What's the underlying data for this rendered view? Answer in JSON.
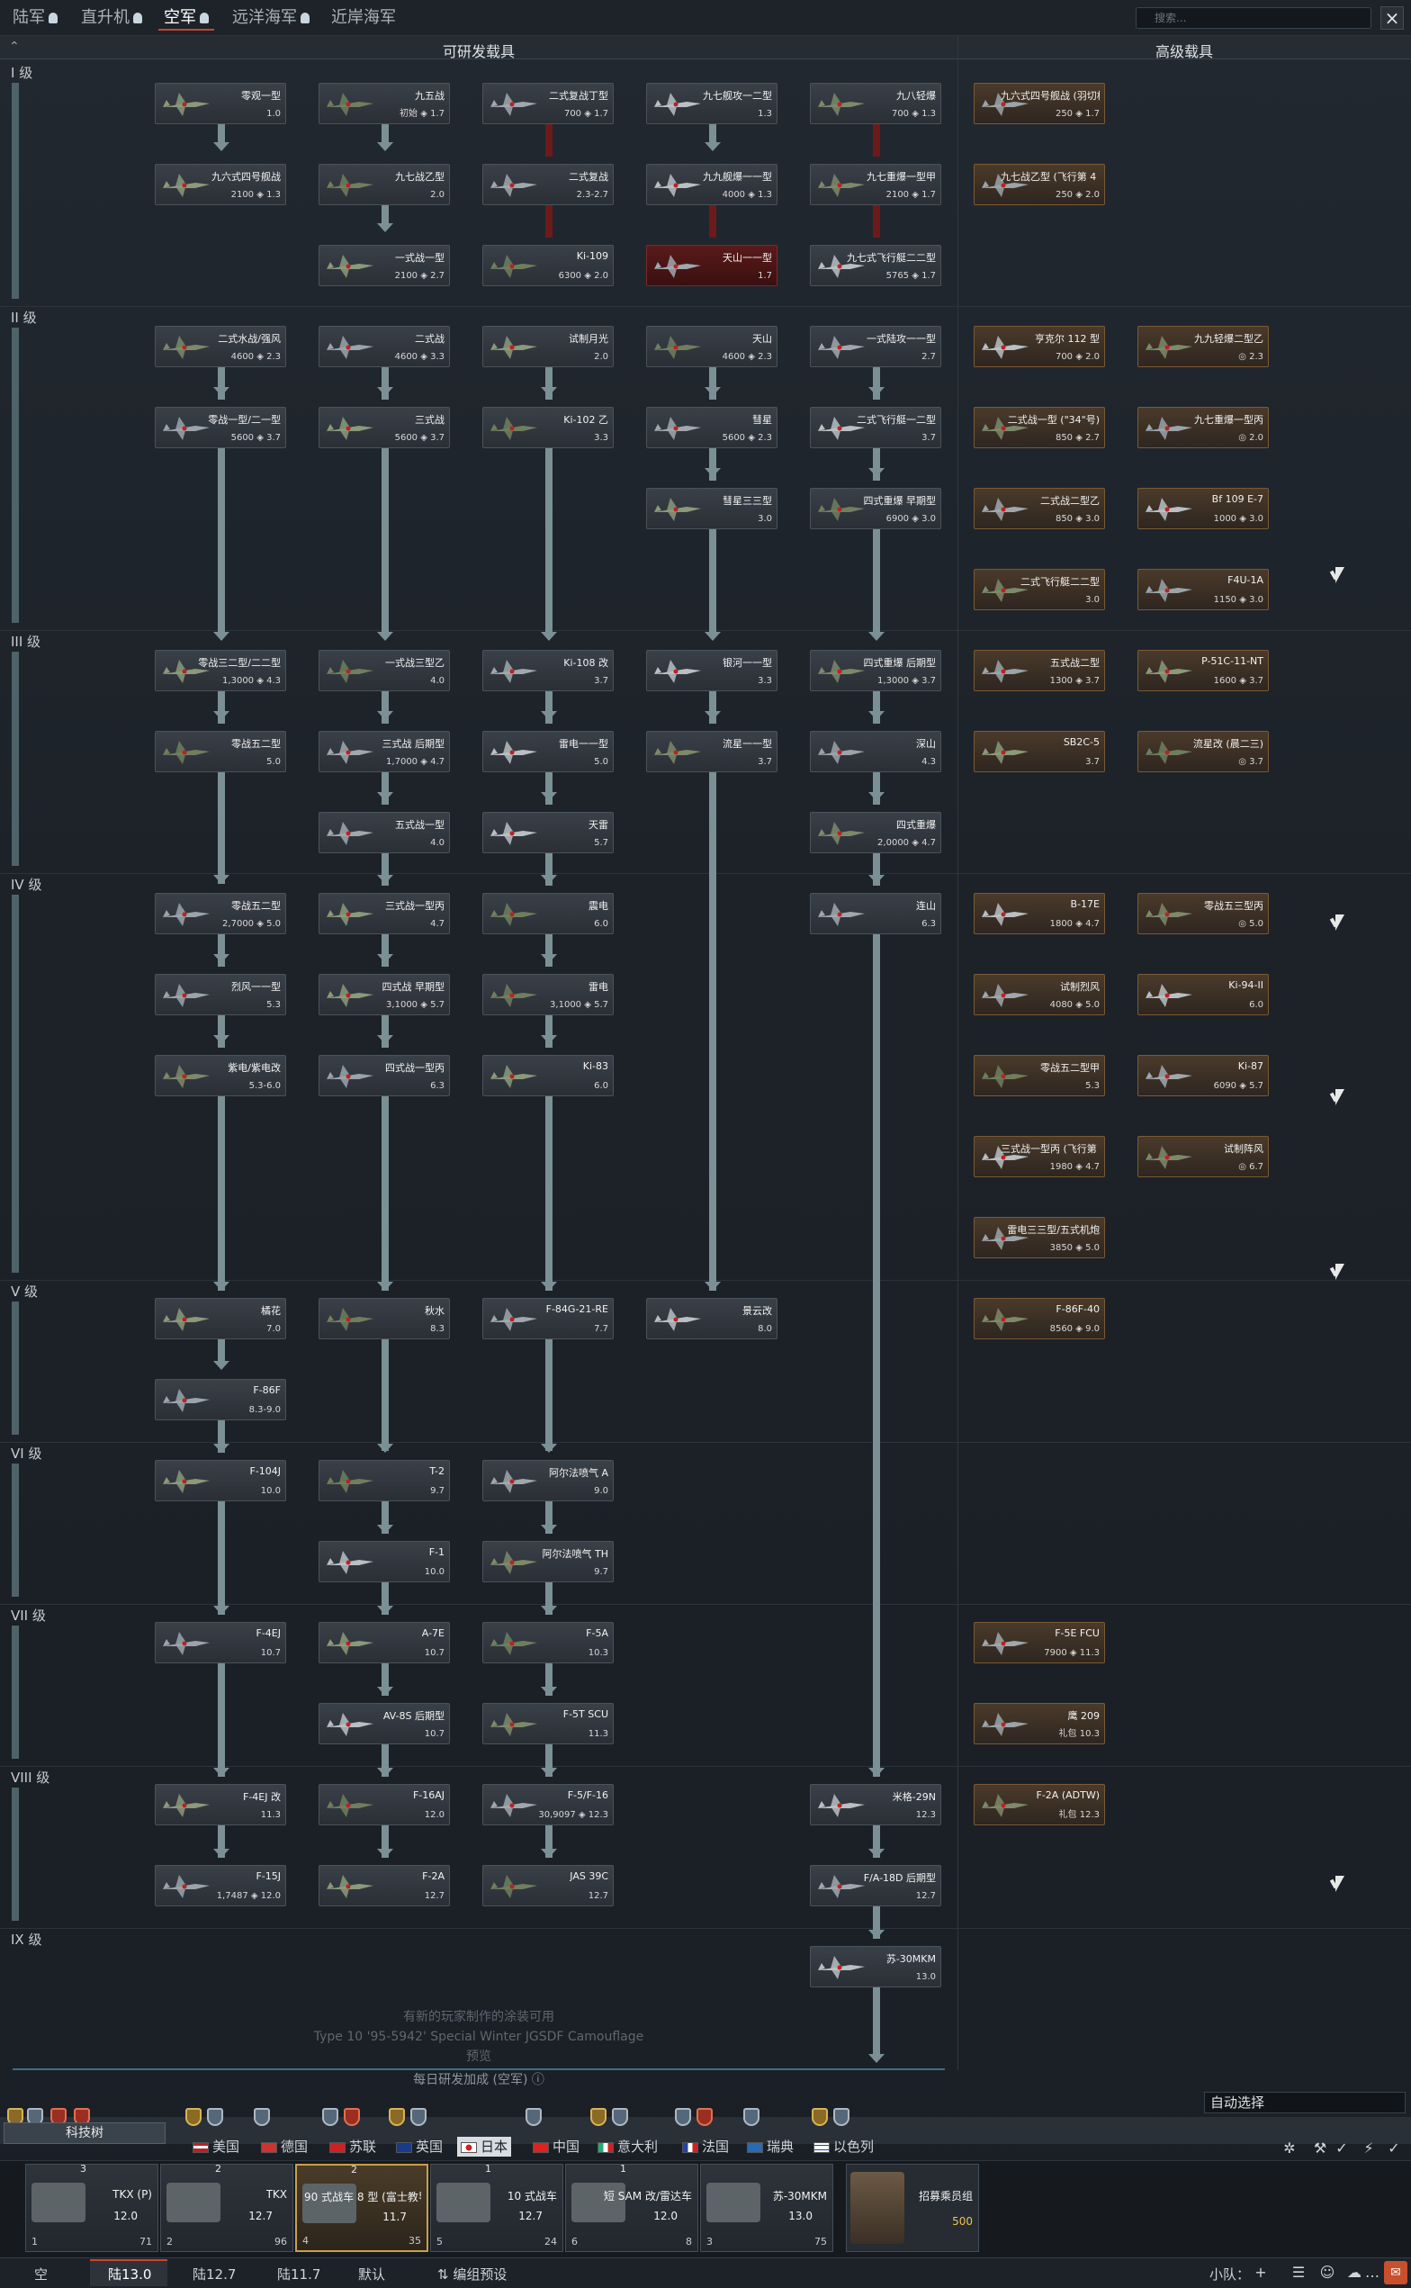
{
  "tabs": [
    {
      "label": "陆军"
    },
    {
      "label": "直升机"
    },
    {
      "label": "空军"
    },
    {
      "label": "远洋海军"
    },
    {
      "label": "近岸海军"
    }
  ],
  "search": {
    "placeholder": "搜索..."
  },
  "headers": {
    "researchable": "可研发载具",
    "premium": "高级载具"
  },
  "ranks": [
    {
      "label": "I 级"
    },
    {
      "label": "II 级"
    },
    {
      "label": "III 级"
    },
    {
      "label": "IV 级"
    },
    {
      "label": "V 级"
    },
    {
      "label": "VI 级"
    },
    {
      "label": "VII 级"
    },
    {
      "label": "VIII 级"
    },
    {
      "label": "IX 级"
    }
  ],
  "vehicles": [
    {
      "name": "零观一型",
      "meta": "1.0"
    },
    {
      "name": "九五战",
      "meta": "初始 ◈ 1.7"
    },
    {
      "name": "二式复战丁型",
      "meta": "700 ◈ 1.7"
    },
    {
      "name": "九七舰攻一二型",
      "meta": "1.3"
    },
    {
      "name": "九八轻爆",
      "meta": "700 ◈ 1.3"
    },
    {
      "name": "九六式四号舰战 (羽切松雄)",
      "meta": "250 ◈ 1.7"
    },
    {
      "name": "九六式四号舰战",
      "meta": "2100 ◈ 1.3"
    },
    {
      "name": "九七战乙型",
      "meta": "2.0"
    },
    {
      "name": "二式复战",
      "meta": "2.3-2.7"
    },
    {
      "name": "九九舰爆一一型",
      "meta": "4000 ◈ 1.3"
    },
    {
      "name": "九七重爆一型甲",
      "meta": "2100 ◈ 1.7"
    },
    {
      "name": "九七战乙型 (飞行第 4 战队)",
      "meta": "250 ◈ 2.0"
    },
    {
      "name": "一式战一型",
      "meta": "2100 ◈ 2.7"
    },
    {
      "name": "Ki-109",
      "meta": "6300 ◈ 2.0"
    },
    {
      "name": "天山一一型",
      "meta": "1.7"
    },
    {
      "name": "九七式飞行艇二二型",
      "meta": "5765 ◈ 1.7"
    },
    {
      "name": "二式水战/强风",
      "meta": "4600 ◈ 2.3"
    },
    {
      "name": "二式战",
      "meta": "4600 ◈ 3.3"
    },
    {
      "name": "试制月光",
      "meta": "2.0"
    },
    {
      "name": "天山",
      "meta": "4600 ◈ 2.3"
    },
    {
      "name": "一式陆攻一一型",
      "meta": "2.7"
    },
    {
      "name": "亨克尔 112 型",
      "meta": "700 ◈ 2.0"
    },
    {
      "name": "九九轻爆二型乙",
      "meta": "◎ 2.3"
    },
    {
      "name": "零战一型/二一型",
      "meta": "5600 ◈ 3.7"
    },
    {
      "name": "三式战",
      "meta": "5600 ◈ 3.7"
    },
    {
      "name": "Ki-102 乙",
      "meta": "3.3"
    },
    {
      "name": "彗星",
      "meta": "5600 ◈ 2.3"
    },
    {
      "name": "二式飞行艇一二型",
      "meta": "3.7"
    },
    {
      "name": "二式战一型 (\"34\"号)",
      "meta": "850 ◈ 2.7"
    },
    {
      "name": "九七重爆一型丙",
      "meta": "◎ 2.0"
    },
    {
      "name": "彗星三三型",
      "meta": "3.0"
    },
    {
      "name": "四式重爆 早期型",
      "meta": "6900 ◈ 3.0"
    },
    {
      "name": "二式战二型乙",
      "meta": "850 ◈ 3.0"
    },
    {
      "name": "Bf 109 E-7",
      "meta": "1000 ◈ 3.0"
    },
    {
      "name": "二式飞行艇二二型",
      "meta": "3.0"
    },
    {
      "name": "F4U-1A",
      "meta": "1150 ◈ 3.0"
    },
    {
      "name": "零战三二型/二二型",
      "meta": "1,3000 ◈ 4.3"
    },
    {
      "name": "一式战三型乙",
      "meta": "4.0"
    },
    {
      "name": "Ki-108 改",
      "meta": "3.7"
    },
    {
      "name": "银河一一型",
      "meta": "3.3"
    },
    {
      "name": "四式重爆 后期型",
      "meta": "1,3000 ◈ 3.7"
    },
    {
      "name": "五式战二型",
      "meta": "1300 ◈ 3.7"
    },
    {
      "name": "P-51C-11-NT",
      "meta": "1600 ◈ 3.7"
    },
    {
      "name": "零战五二型",
      "meta": "5.0"
    },
    {
      "name": "三式战 后期型",
      "meta": "1,7000 ◈ 4.7"
    },
    {
      "name": "雷电一一型",
      "meta": "5.0"
    },
    {
      "name": "流星一一型",
      "meta": "3.7"
    },
    {
      "name": "深山",
      "meta": "4.3"
    },
    {
      "name": "SB2C-5",
      "meta": "3.7"
    },
    {
      "name": "流星改 (晨二三)",
      "meta": "◎ 3.7"
    },
    {
      "name": "五式战一型",
      "meta": "4.0"
    },
    {
      "name": "天雷",
      "meta": "5.7"
    },
    {
      "name": "四式重爆",
      "meta": "2,0000 ◈ 4.7"
    },
    {
      "name": "零战五二型",
      "meta": "2,7000 ◈ 5.0"
    },
    {
      "name": "三式战一型丙",
      "meta": "4.7"
    },
    {
      "name": "震电",
      "meta": "6.0"
    },
    {
      "name": "连山",
      "meta": "6.3"
    },
    {
      "name": "B-17E",
      "meta": "1800 ◈ 4.7"
    },
    {
      "name": "零战五三型丙",
      "meta": "◎ 5.0"
    },
    {
      "name": "烈风一一型",
      "meta": "5.3"
    },
    {
      "name": "四式战 早期型",
      "meta": "3,1000 ◈ 5.7"
    },
    {
      "name": "雷电",
      "meta": "3,1000 ◈ 5.7"
    },
    {
      "name": "试制烈风",
      "meta": "4080 ◈ 5.0"
    },
    {
      "name": "Ki-94-II",
      "meta": "6.0"
    },
    {
      "name": "紫电/紫电改",
      "meta": "5.3-6.0"
    },
    {
      "name": "四式战一型丙",
      "meta": "6.3"
    },
    {
      "name": "Ki-83",
      "meta": "6.0"
    },
    {
      "name": "零战五二型甲",
      "meta": "5.3"
    },
    {
      "name": "Ki-87",
      "meta": "6090 ◈ 5.7"
    },
    {
      "name": "三式战一型丙 (飞行第 78 战队)",
      "meta": "1980 ◈ 4.7"
    },
    {
      "name": "试制阵风",
      "meta": "◎ 6.7"
    },
    {
      "name": "雷电三三型/五式机炮",
      "meta": "3850 ◈ 5.0"
    },
    {
      "name": "橘花",
      "meta": "7.0"
    },
    {
      "name": "秋水",
      "meta": "8.3"
    },
    {
      "name": "F-84G-21-RE",
      "meta": "7.7"
    },
    {
      "name": "景云改",
      "meta": "8.0"
    },
    {
      "name": "F-86F-40",
      "meta": "8560 ◈ 9.0"
    },
    {
      "name": "F-86F",
      "meta": "8.3-9.0"
    },
    {
      "name": "F-104J",
      "meta": "10.0"
    },
    {
      "name": "T-2",
      "meta": "9.7"
    },
    {
      "name": "阿尔法喷气 A",
      "meta": "9.0"
    },
    {
      "name": "F-1",
      "meta": "10.0"
    },
    {
      "name": "阿尔法喷气 TH",
      "meta": "9.7"
    },
    {
      "name": "F-4EJ",
      "meta": "10.7"
    },
    {
      "name": "A-7E",
      "meta": "10.7"
    },
    {
      "name": "F-5A",
      "meta": "10.3"
    },
    {
      "name": "F-5E FCU",
      "meta": "7900 ◈ 11.3"
    },
    {
      "name": "AV-8S 后期型",
      "meta": "10.7"
    },
    {
      "name": "F-5T SCU",
      "meta": "11.3"
    },
    {
      "name": "鹰 209",
      "meta": "礼包 10.3"
    },
    {
      "name": "F-4EJ 改",
      "meta": "11.3"
    },
    {
      "name": "F-16AJ",
      "meta": "12.0"
    },
    {
      "name": "F-5/F-16",
      "meta": "30,9097 ◈ 12.3"
    },
    {
      "name": "米格-29N",
      "meta": "12.3"
    },
    {
      "name": "F-2A (ADTW)",
      "meta": "礼包 12.3"
    },
    {
      "name": "F-15J",
      "meta": "1,7487 ◈ 12.0"
    },
    {
      "name": "F-2A",
      "meta": "12.7"
    },
    {
      "name": "JAS 39C",
      "meta": "12.7"
    },
    {
      "name": "F/A-18D 后期型",
      "meta": "12.7"
    },
    {
      "name": "苏-30MKM",
      "meta": "13.0"
    }
  ],
  "banner": {
    "line1": "有新的玩家制作的涂装可用",
    "line2": "Type 10 '95-5942' Special Winter JGSDF Camouflage",
    "line3": "预览"
  },
  "research_label": "每日研发加成 (空军) ⓘ",
  "auto_select": "自动选择",
  "techtree_label": "科技树",
  "nations": [
    {
      "label": "美国"
    },
    {
      "label": "德国"
    },
    {
      "label": "苏联"
    },
    {
      "label": "英国"
    },
    {
      "label": "日本"
    },
    {
      "label": "中国"
    },
    {
      "label": "意大利"
    },
    {
      "label": "法国"
    },
    {
      "label": "瑞典"
    },
    {
      "label": "以色列"
    }
  ],
  "crew": [
    {
      "level": "3",
      "name": "TKX (P)",
      "br": "12.0",
      "slot": "1",
      "count": "71"
    },
    {
      "level": "2",
      "name": "TKX",
      "br": "12.7",
      "slot": "2",
      "count": "96"
    },
    {
      "level": "2",
      "name": "90 式战车 8 型 (富士教导)",
      "br": "11.7",
      "slot": "4",
      "count": "35"
    },
    {
      "level": "1",
      "name": "10 式战车",
      "br": "12.7",
      "slot": "5",
      "count": "24"
    },
    {
      "level": "1",
      "name": "短 SAM 改/雷达车",
      "br": "12.0",
      "slot": "6",
      "count": "8"
    },
    {
      "level": "",
      "name": "苏-30MKM",
      "br": "13.0",
      "slot": "3",
      "count": "75"
    }
  ],
  "recruit": {
    "label": "招募乘员组",
    "value": "500"
  },
  "bottom_tabs": [
    {
      "label": "空"
    },
    {
      "label": "陆13.0"
    },
    {
      "label": "陆12.7"
    },
    {
      "label": "陆11.7"
    },
    {
      "label": "默认"
    },
    {
      "label": "编组预设"
    }
  ],
  "squad_label": "小队：",
  "colors": {
    "accent": "#c8462e",
    "premium": "#c8a04a",
    "connector": "#7a9094"
  }
}
